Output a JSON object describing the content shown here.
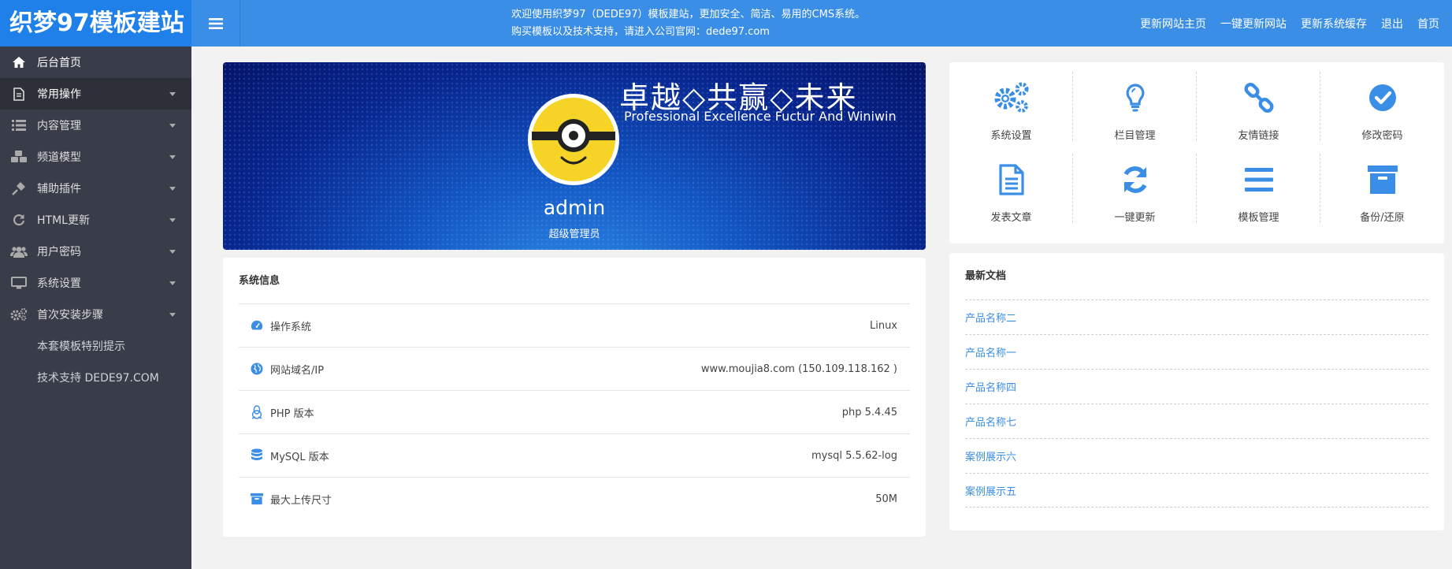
{
  "header": {
    "logo": "织梦97模板建站",
    "welcome_line1": "欢迎使用织梦97（DEDE97）模板建站，更加安全、简洁、易用的CMS系统。",
    "welcome_line2": "购买模板以及技术支持，请进入公司官网：dede97.com",
    "links": [
      "更新网站主页",
      "一键更新网站",
      "更新系统缓存",
      "退出",
      "首页"
    ]
  },
  "sidebar": {
    "items": [
      {
        "label": "后台首页",
        "icon": "home-icon"
      },
      {
        "label": "常用操作",
        "icon": "document-icon"
      },
      {
        "label": "内容管理",
        "icon": "list-icon"
      },
      {
        "label": "频道模型",
        "icon": "cubes-icon"
      },
      {
        "label": "辅助插件",
        "icon": "plug-icon"
      },
      {
        "label": "HTML更新",
        "icon": "refresh-icon"
      },
      {
        "label": "用户密码",
        "icon": "users-icon"
      },
      {
        "label": "系统设置",
        "icon": "monitor-icon"
      },
      {
        "label": "首次安装步骤",
        "icon": "gears-icon"
      }
    ],
    "sub_items": [
      "本套模板特别提示",
      "技术支持 DEDE97.COM"
    ]
  },
  "banner": {
    "slogan": "卓越◇共赢◇未来",
    "slogan_en": "Professional Excellence Fuctur And Winiwin",
    "username": "admin",
    "role": "超级管理员"
  },
  "system_info": {
    "title": "系统信息",
    "rows": [
      {
        "label": "操作系统",
        "value": "Linux",
        "icon": "dashboard-icon"
      },
      {
        "label": "网站域名/IP",
        "value": "www.moujia8.com (150.109.118.162 )",
        "icon": "globe-icon"
      },
      {
        "label": "PHP 版本",
        "value": "php 5.4.45",
        "icon": "linux-icon"
      },
      {
        "label": "MySQL 版本",
        "value": "mysql 5.5.62-log",
        "icon": "database-icon"
      },
      {
        "label": "最大上传尺寸",
        "value": "50M",
        "icon": "archive-icon"
      }
    ]
  },
  "quick_links": [
    {
      "label": "系统设置",
      "icon": "gears-icon"
    },
    {
      "label": "栏目管理",
      "icon": "lightbulb-icon"
    },
    {
      "label": "友情链接",
      "icon": "link-icon"
    },
    {
      "label": "修改密码",
      "icon": "check-circle-icon"
    },
    {
      "label": "发表文章",
      "icon": "file-text-icon"
    },
    {
      "label": "一键更新",
      "icon": "refresh-icon"
    },
    {
      "label": "模板管理",
      "icon": "bars-icon"
    },
    {
      "label": "备份/还原",
      "icon": "archive-icon"
    }
  ],
  "latest_docs": {
    "title": "最新文档",
    "items": [
      "产品名称二",
      "产品名称一",
      "产品名称四",
      "产品名称七",
      "案例展示六",
      "案例展示五"
    ]
  },
  "colors": {
    "accent": "#3a8ee6",
    "logo_bg": "#1e80e8",
    "sidebar_bg": "#393d49"
  }
}
